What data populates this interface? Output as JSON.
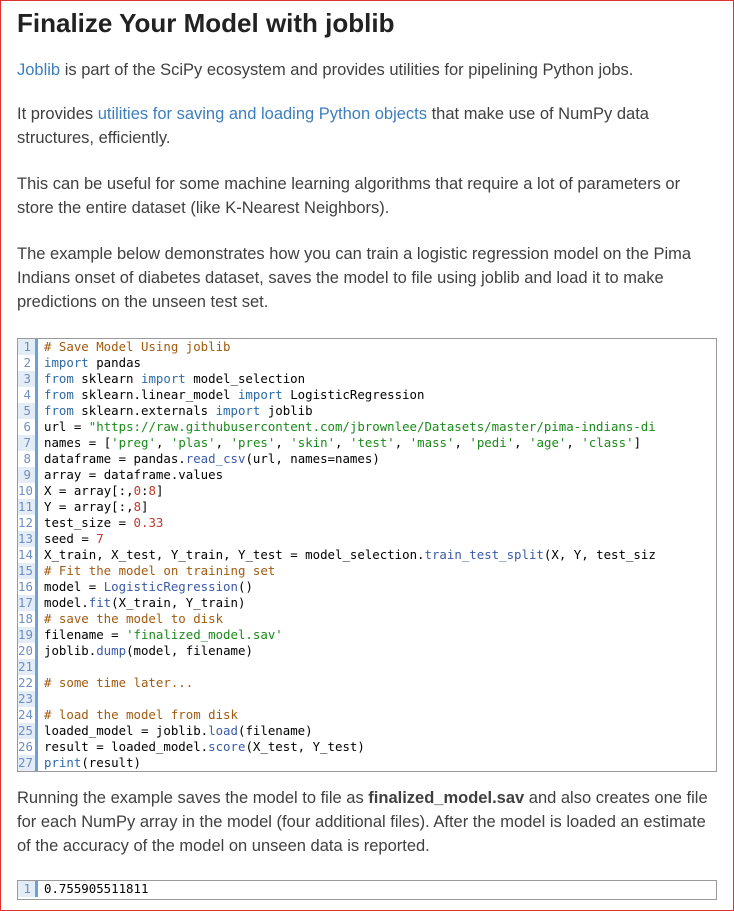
{
  "title": "Finalize Your Model with joblib",
  "para1": {
    "link": "Joblib",
    "text": " is part of the SciPy ecosystem and provides utilities for pipelining Python jobs."
  },
  "para2": {
    "before": "It provides ",
    "link": "utilities for saving and loading Python objects",
    "after": " that make use of NumPy data structures, efficiently."
  },
  "para3": "This can be useful for some machine learning algorithms that require a lot of parameters or store the entire dataset (like K-Nearest Neighbors).",
  "para4": "The example below demonstrates how you can train a logistic regression model on the Pima Indians onset of diabetes dataset, saves the model to file using joblib and load it to make predictions on the unseen test set.",
  "code": [
    {
      "n": "1",
      "t": "# Save Model Using joblib"
    },
    {
      "n": "2",
      "t": "import pandas"
    },
    {
      "n": "3",
      "t": "from sklearn import model_selection"
    },
    {
      "n": "4",
      "t": "from sklearn.linear_model import LogisticRegression"
    },
    {
      "n": "5",
      "t": "from sklearn.externals import joblib"
    },
    {
      "n": "6",
      "t": "url = \"https://raw.githubusercontent.com/jbrownlee/Datasets/master/pima-indians-di"
    },
    {
      "n": "7",
      "t": "names = ['preg', 'plas', 'pres', 'skin', 'test', 'mass', 'pedi', 'age', 'class']"
    },
    {
      "n": "8",
      "t": "dataframe = pandas.read_csv(url, names=names)"
    },
    {
      "n": "9",
      "t": "array = dataframe.values"
    },
    {
      "n": "10",
      "t": "X = array[:,0:8]"
    },
    {
      "n": "11",
      "t": "Y = array[:,8]"
    },
    {
      "n": "12",
      "t": "test_size = 0.33"
    },
    {
      "n": "13",
      "t": "seed = 7"
    },
    {
      "n": "14",
      "t": "X_train, X_test, Y_train, Y_test = model_selection.train_test_split(X, Y, test_siz"
    },
    {
      "n": "15",
      "t": "# Fit the model on training set"
    },
    {
      "n": "16",
      "t": "model = LogisticRegression()"
    },
    {
      "n": "17",
      "t": "model.fit(X_train, Y_train)"
    },
    {
      "n": "18",
      "t": "# save the model to disk"
    },
    {
      "n": "19",
      "t": "filename = 'finalized_model.sav'"
    },
    {
      "n": "20",
      "t": "joblib.dump(model, filename)"
    },
    {
      "n": "21",
      "t": ""
    },
    {
      "n": "22",
      "t": "# some time later..."
    },
    {
      "n": "23",
      "t": ""
    },
    {
      "n": "24",
      "t": "# load the model from disk"
    },
    {
      "n": "25",
      "t": "loaded_model = joblib.load(filename)"
    },
    {
      "n": "26",
      "t": "result = loaded_model.score(X_test, Y_test)"
    },
    {
      "n": "27",
      "t": "print(result)"
    }
  ],
  "para5": {
    "before": "Running the example saves the model to file as ",
    "bold": "finalized_model.sav",
    "after": " and also creates one file for each NumPy array in the model (four additional files). After the model is loaded an estimate of the accuracy of the model on unseen data is reported."
  },
  "output": [
    {
      "n": "1",
      "t": "0.755905511811"
    }
  ]
}
